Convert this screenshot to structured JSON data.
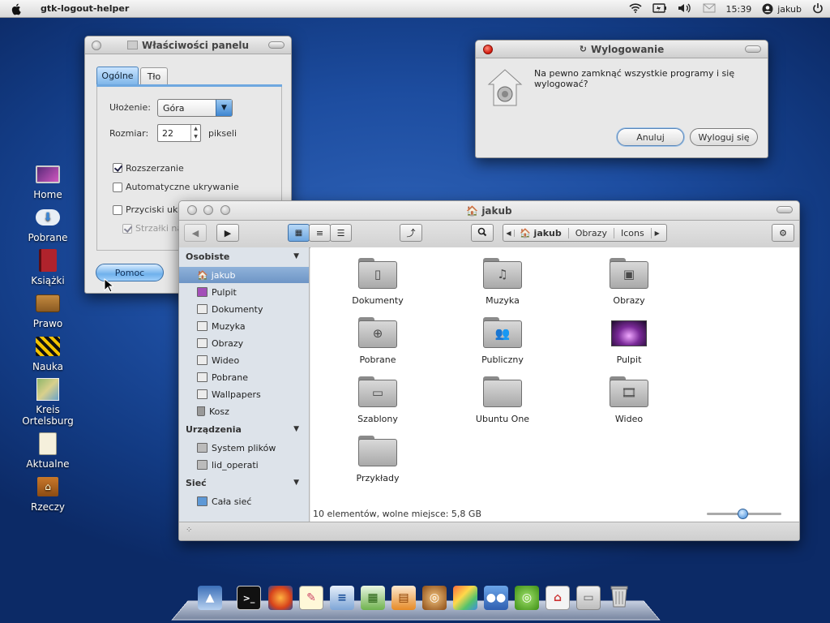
{
  "topbar": {
    "app_name": "gtk-logout-helper",
    "time": "15:39",
    "user": "jakub"
  },
  "desktop_icons": [
    {
      "label": "Home"
    },
    {
      "label": "Pobrane"
    },
    {
      "label": "Książki"
    },
    {
      "label": "Prawo"
    },
    {
      "label": "Nauka"
    },
    {
      "label": "Kreis Ortelsburg"
    },
    {
      "label": "Aktualne"
    },
    {
      "label": "Rzeczy"
    }
  ],
  "panel_props": {
    "title": "Właściwości panelu",
    "tabs": [
      "Ogólne",
      "Tło"
    ],
    "layout_label": "Ułożenie:",
    "layout_value": "Góra",
    "size_label": "Rozmiar:",
    "size_value": "22",
    "size_unit": "pikseli",
    "expand_label": "Rozszerzanie",
    "autohide_label": "Automatyczne ukrywanie",
    "hide_buttons_label": "Przyciski ukry",
    "arrows_label": "Strzałki na",
    "help_button": "Pomoc"
  },
  "logout_dialog": {
    "title": "Wylogowanie",
    "message": "Na pewno zamknąć wszystkie programy i się wylogować?",
    "cancel": "Anuluj",
    "logout": "Wyloguj się"
  },
  "file_manager": {
    "title": "jakub",
    "breadcrumb": [
      "jakub",
      "Obrazy",
      "Icons"
    ],
    "sidebar": {
      "personal_header": "Osobiste",
      "personal": [
        "jakub",
        "Pulpit",
        "Dokumenty",
        "Muzyka",
        "Obrazy",
        "Wideo",
        "Pobrane",
        "Wallpapers",
        "Kosz"
      ],
      "devices_header": "Urządzenia",
      "devices": [
        "System plików",
        "lid_operati"
      ],
      "network_header": "Sieć",
      "network": [
        "Cała sieć"
      ]
    },
    "items": [
      "Dokumenty",
      "Muzyka",
      "Obrazy",
      "Pobrane",
      "Publiczny",
      "Pulpit",
      "Szablony",
      "Ubuntu One",
      "Wideo",
      "Przykłady"
    ],
    "status": "10 elementów, wolne miejsce: 5,8 GB"
  },
  "colors": {
    "accent": "#6fb1ec",
    "close_red": "#d1170a",
    "selection": "#7a9fcd"
  }
}
